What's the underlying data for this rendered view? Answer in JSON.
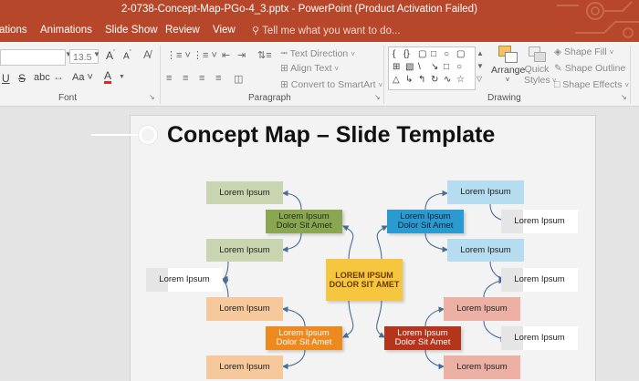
{
  "window": {
    "title": "2-0738-Concept-Map-PGo-4_3.pptx  -  PowerPoint (Product Activation Failed)"
  },
  "tabs": [
    {
      "label": "ations"
    },
    {
      "label": "Animations"
    },
    {
      "label": "Slide Show"
    },
    {
      "label": "Review"
    },
    {
      "label": "View"
    }
  ],
  "tell_me": {
    "placeholder": "Tell me what you want to do..."
  },
  "ribbon": {
    "font": {
      "size": "13.5",
      "group_label": "Font"
    },
    "paragraph": {
      "text_direction": "Text Direction",
      "align_text": "Align Text",
      "convert_smartart": "Convert to SmartArt",
      "group_label": "Paragraph"
    },
    "drawing": {
      "arrange": "Arrange",
      "quick_styles_1": "Quick",
      "quick_styles_2": "Styles",
      "shape_fill": "Shape Fill",
      "shape_outline": "Shape Outline",
      "shape_effects": "Shape Effects",
      "group_label": "Drawing"
    }
  },
  "slide": {
    "title": "Concept Map – Slide Template",
    "center": {
      "line1": "LOREM IPSUM",
      "line2": "DOLOR SIT AMET"
    },
    "mid_nodes": [
      {
        "line1": "Lorem Ipsum",
        "line2": "Dolor Sit Amet",
        "color": "#8aa653"
      },
      {
        "line1": "Lorem Ipsum",
        "line2": "Dolor Sit Amet",
        "color": "#2b9ad1"
      },
      {
        "line1": "Lorem Ipsum",
        "line2": "Dolor Sit Amet",
        "color": "#ec8a1f"
      },
      {
        "line1": "Lorem Ipsum",
        "line2": "Dolor Sit Amet",
        "color": "#b5341c"
      }
    ],
    "leaves": [
      "Lorem Ipsum",
      "Lorem Ipsum",
      "Lorem Ipsum",
      "Lorem Ipsum",
      "Lorem Ipsum",
      "Lorem Ipsum",
      "Lorem Ipsum",
      "Lorem Ipsum",
      "Lorem Ipsum",
      "Lorem Ipsum",
      "Lorem Ipsum",
      "Lorem Ipsum"
    ],
    "colors": {
      "center": "#f7c63f",
      "green_leaf": "#c9d5b0",
      "blue_leaf": "#b5dcef",
      "orange_leaf": "#f5c99b",
      "red_leaf": "#ecb0a4",
      "white_leaf": "#ffffff",
      "connector": "#4a6d96"
    }
  }
}
